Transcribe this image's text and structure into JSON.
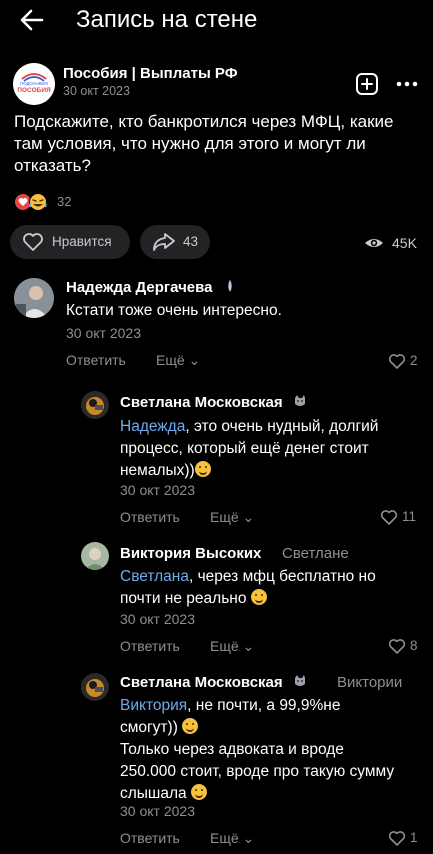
{
  "header": {
    "title": "Запись на стене"
  },
  "post": {
    "group_name": "Пособия | Выплаты РФ",
    "avatar_text": "ПОДСКАЖЕМ ПОСОБИЯ",
    "date": "30 окт 2023",
    "text": "Подскажите, кто банкротился через МФЦ, какие там условия, что нужно для этого и могут ли отказать?",
    "reactions_count": "32",
    "like_label": "Нравится",
    "share_count": "43",
    "views": "45K"
  },
  "comments": [
    {
      "name": "Надежда Дергачева",
      "reply_to": "",
      "mention": "",
      "text": "Кстати тоже очень интересно.",
      "date": "30 окт 2023",
      "reply_label": "Ответить",
      "more_label": "Ещё",
      "likes": "2"
    },
    {
      "name": "Светлана Московская",
      "reply_to": "",
      "mention": "Надежда",
      "text": ", это очень нудный, долгий процесс, который ещё денег стоит немалых))",
      "date": "30 окт 2023",
      "reply_label": "Ответить",
      "more_label": "Ещё",
      "likes": "11"
    },
    {
      "name": "Виктория Высоких",
      "reply_to": "Светлане",
      "mention": "Светлана",
      "text": ", через мфц бесплатно но почти не реально",
      "date": "30 окт 2023",
      "reply_label": "Ответить",
      "more_label": "Ещё",
      "likes": "8"
    },
    {
      "name": "Светлана Московская",
      "reply_to": "Виктории",
      "mention": "Виктория",
      "text_line1": ", не почти, а 99,9%не смогут))",
      "text_line2": "Только через адвоката и вроде 250.000 стоит, вроде про такую сумму слышала",
      "date": "30 окт 2023",
      "reply_label": "Ответить",
      "more_label": "Ещё",
      "likes": "1"
    }
  ],
  "colors": {
    "background": "#000000",
    "link": "#71aaeb",
    "muted": "#8c8f94",
    "pill": "#232325",
    "heart_red": "#e64646"
  }
}
